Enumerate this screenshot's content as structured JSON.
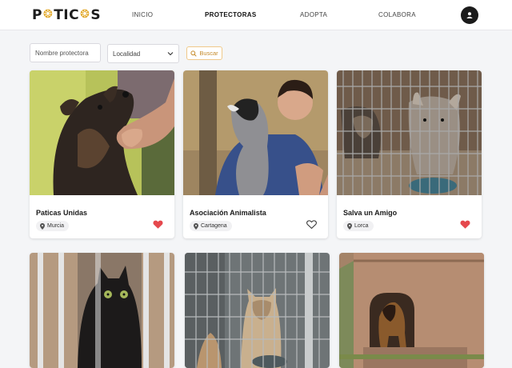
{
  "nav": {
    "logo_text": "PATICAS",
    "links": [
      {
        "label": "INICIO"
      },
      {
        "label": "PROTECTORAS",
        "active": true
      },
      {
        "label": "ADOPTA"
      },
      {
        "label": "COLABORA"
      }
    ],
    "avatar_icon": "user-icon"
  },
  "filters": {
    "name_placeholder": "Nombre protectora",
    "locality_label": "Localidad",
    "search_label": "Buscar"
  },
  "shelters": [
    {
      "name": "Paticas Unidas",
      "location": "Murcia",
      "favorite": true
    },
    {
      "name": "Asociación Animalista",
      "location": "Cartagena",
      "favorite": false
    },
    {
      "name": "Salva un Amigo",
      "location": "Lorca",
      "favorite": true
    },
    {
      "name": "",
      "location": "",
      "favorite": false
    },
    {
      "name": "",
      "location": "",
      "favorite": false
    },
    {
      "name": "",
      "location": "",
      "favorite": false
    }
  ],
  "colors": {
    "accent": "#e0a21a",
    "heart_filled": "#e5484d",
    "nav_bg": "#ffffff",
    "page_bg": "#f4f5f7"
  }
}
